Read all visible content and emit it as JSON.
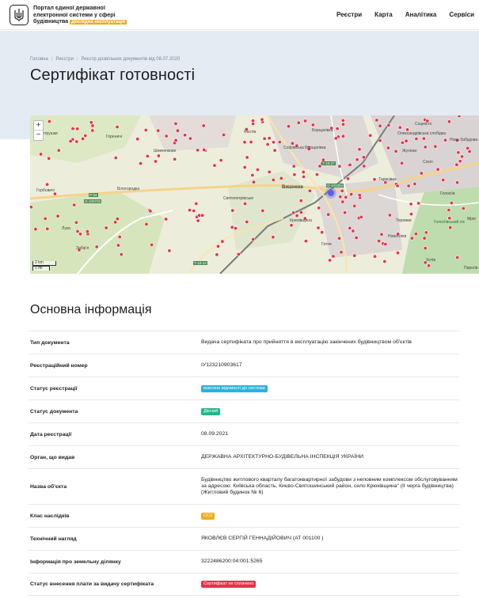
{
  "header": {
    "brand_line1": "Портал єдиної державної",
    "brand_line2": "електронної системи у сфері",
    "brand_line3": "будівництва",
    "brand_badge": "Дослідна експлуатація",
    "nav": [
      "Реєстри",
      "Карта",
      "Аналітика",
      "Сервіси"
    ]
  },
  "breadcrumb": [
    "Головна",
    "Реєстри",
    "Реєстр дозвільних документів від 08.07.2020"
  ],
  "page_title": "Сертифікат готовності",
  "map": {
    "zoom_in": "+",
    "zoom_out": "−",
    "scale_km": "2 km",
    "scale_mi": "1 mi",
    "labels": [
      "Петрушки",
      "Гореничі",
      "Шевченкове",
      "Горбовичі",
      "Білогородка",
      "Лука",
      "Забір'я",
      "Святопетрівське",
      "Вишневе",
      "Крюківщина",
      "Гатне",
      "Тарасівка",
      "Софіївська Борщагівка",
      "Борщагівка",
      "Теремки",
      "Голосіїв",
      "Новосілки",
      "Пирогів",
      "Хотів",
      "Соцмісто",
      "Олександрівська слобідка",
      "Нова Забудова",
      "Голосіївський ліс",
      "Мрія",
      "Сокіл",
      "Жуляни",
      "Фастів"
    ],
    "road_labels": [
      "Р-04",
      "О-100720",
      "Т-10-27",
      "О-101304",
      "Т-10-12"
    ]
  },
  "section_title": "Основна інформація",
  "fields": [
    {
      "label": "Тип документа",
      "value": "Видача сертифіката про прийняття в експлуатацію закінчених будівництвом об'єктів"
    },
    {
      "label": "Реєстраційний номер",
      "value": "ІУ123210903617"
    },
    {
      "label": "Статус реєстрації",
      "tag": "внесено відомості до системи",
      "tag_color": "#2bb3e0"
    },
    {
      "label": "Статус документа",
      "tag": "Діючий",
      "tag_color": "#1fb98b"
    },
    {
      "label": "Дата реєстрації",
      "value": "08.09.2021"
    },
    {
      "label": "Орган, що видав",
      "value": "ДЕРЖАВНА АРХІТЕКТУРНО-БУДІВЕЛЬНА ІНСПЕКЦІЯ УКРАЇНИ"
    },
    {
      "label": "Назва об'єкта",
      "value": "Будівництво житлового кварталу багатоквартирної забудови з неповним комплексом обслуговуванням за адресою: Київська область, Києво-Святошинський район, село Крюківщина\" (ІІ черга будівництва) (Житловий будинок № 6)"
    },
    {
      "label": "Клас наслідків",
      "tag": "СС2",
      "tag_color": "#f0ad24"
    },
    {
      "label": "Технічний нагляд",
      "value": "ЯКОВЛЄВ СЕРГІЙ ГЕННАДІЙОВИЧ (АТ 001100 )"
    },
    {
      "label": "Інформація про земельну ділянку",
      "value": "3222486200:04:001:5265"
    },
    {
      "label": "Статус внесення плати за видачу сертифіката",
      "tag": "Сертифікат не сплачено",
      "tag_color": "#e5334a"
    }
  ]
}
